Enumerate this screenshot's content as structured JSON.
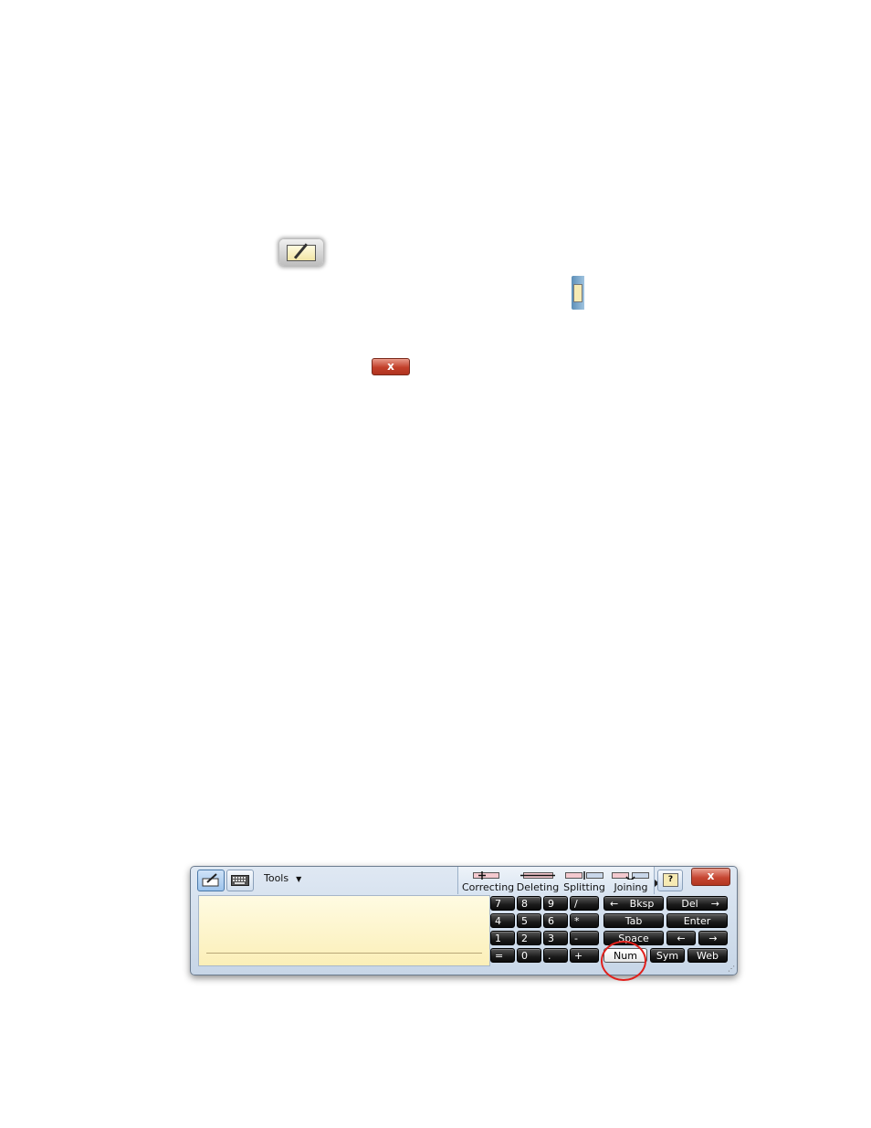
{
  "doc_icons": {
    "tip_icon": "input-panel-tip-icon",
    "tab_icon": "input-panel-tab-icon",
    "close_label": "x"
  },
  "panel": {
    "mode_buttons": [
      {
        "name": "writing-pad-mode",
        "icon": "pen-pad-icon",
        "active": true
      },
      {
        "name": "touch-keyboard-mode",
        "icon": "keyboard-icon",
        "active": false
      }
    ],
    "tools_label": "Tools",
    "gestures": [
      {
        "label": "Correcting",
        "icon": "correcting-gesture-icon"
      },
      {
        "label": "Deleting",
        "icon": "deleting-gesture-icon"
      },
      {
        "label": "Splitting",
        "icon": "splitting-gesture-icon"
      },
      {
        "label": "Joining",
        "icon": "joining-gesture-icon"
      }
    ],
    "close_label": "x",
    "keypad": {
      "row1": [
        "7",
        "8",
        "9",
        "/"
      ],
      "row2": [
        "4",
        "5",
        "6",
        "*"
      ],
      "row3": [
        "1",
        "2",
        "3",
        "-"
      ],
      "row4": [
        "=",
        "0",
        ".",
        "+"
      ]
    },
    "keys": {
      "bksp": "Bksp",
      "del": "Del",
      "tab": "Tab",
      "enter": "Enter",
      "space": "Space",
      "left_arrow": "←",
      "right_arrow": "→",
      "num": "Num",
      "sym": "Sym",
      "web": "Web"
    },
    "selected_key": "Num"
  },
  "colors": {
    "writing_pad": "#fbefb8",
    "close_red": "#c64632",
    "highlight_ring": "#e0201c"
  }
}
